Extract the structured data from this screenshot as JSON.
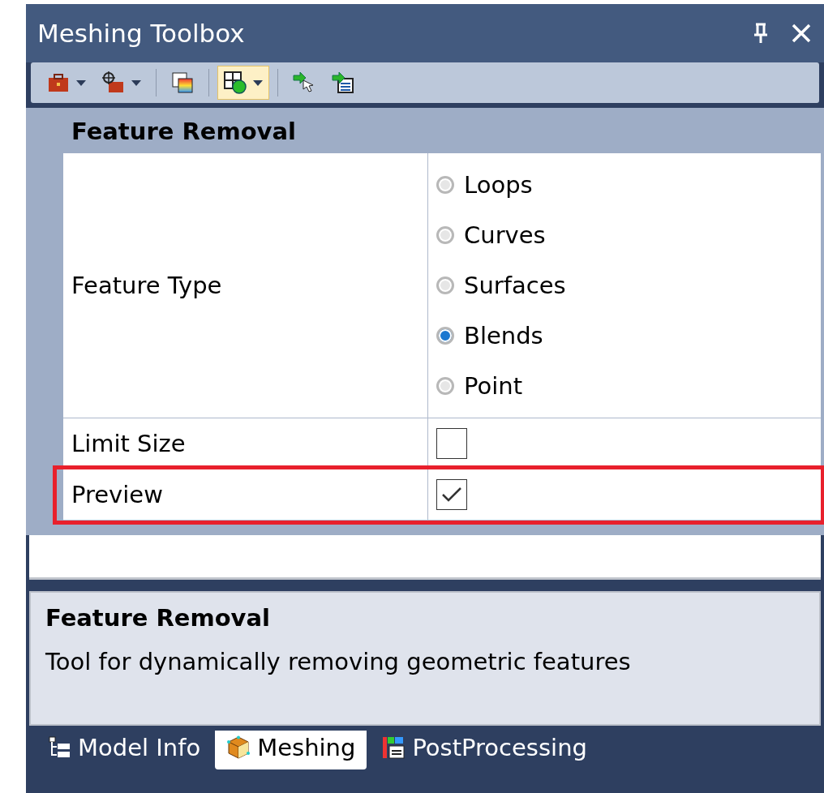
{
  "window": {
    "title": "Meshing Toolbox"
  },
  "toolbar": [
    {
      "dropdown": true,
      "selected": false
    },
    {
      "dropdown": true,
      "selected": false
    },
    {
      "dropdown": false,
      "selected": false
    },
    {
      "dropdown": true,
      "selected": true
    },
    {
      "dropdown": false,
      "selected": false
    },
    {
      "dropdown": false,
      "selected": false
    }
  ],
  "section": {
    "title": "Feature Removal",
    "properties": [
      {
        "kind": "radio",
        "label": "Feature Type",
        "options": [
          {
            "label": "Loops",
            "selected": false
          },
          {
            "label": "Curves",
            "selected": false
          },
          {
            "label": "Surfaces",
            "selected": false
          },
          {
            "label": "Blends",
            "selected": true
          },
          {
            "label": "Point",
            "selected": false
          }
        ]
      },
      {
        "kind": "checkbox",
        "label": "Limit Size",
        "checked": false,
        "highlighted": false
      },
      {
        "kind": "checkbox",
        "label": "Preview",
        "checked": true,
        "highlighted": true
      }
    ]
  },
  "description": {
    "title": "Feature Removal",
    "text": "Tool for dynamically removing geometric features"
  },
  "tabs": [
    {
      "label": "Model Info",
      "selected": false
    },
    {
      "label": "Meshing",
      "selected": true
    },
    {
      "label": "PostProcessing",
      "selected": false
    }
  ]
}
